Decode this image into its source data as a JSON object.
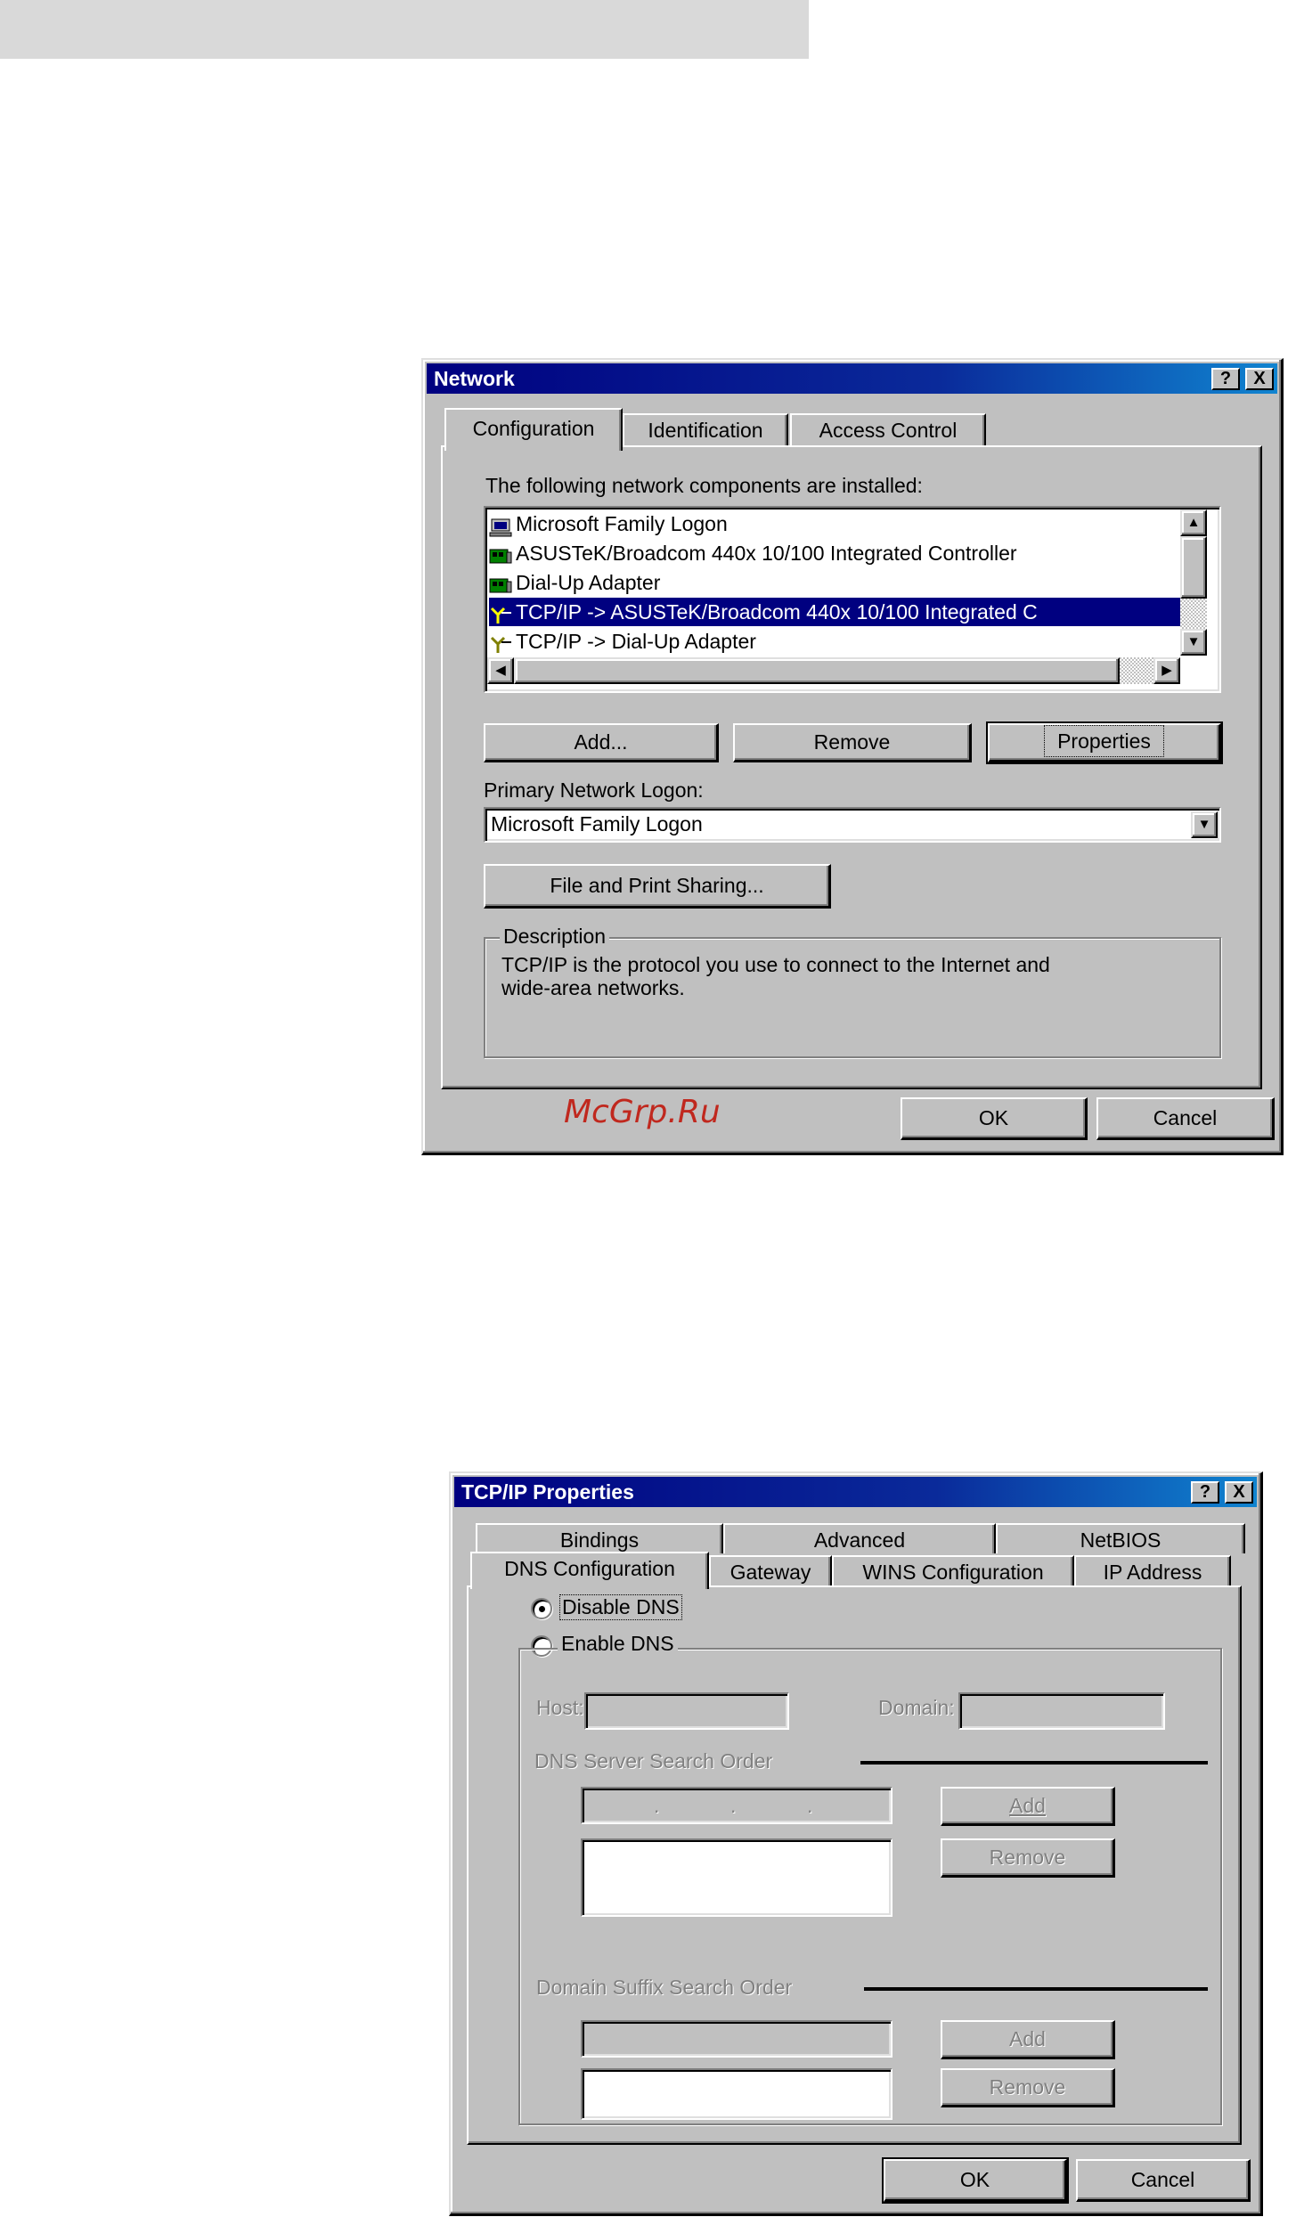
{
  "network": {
    "title": "Network",
    "help_btn": "?",
    "close_btn": "X",
    "tabs": [
      "Configuration",
      "Identification",
      "Access Control"
    ],
    "installed_label": "The following network components are installed:",
    "components": [
      {
        "label": "Microsoft Family Logon",
        "icon": "computer-icon",
        "selected": false
      },
      {
        "label": "ASUSTeK/Broadcom 440x 10/100 Integrated Controller",
        "icon": "network-card-icon",
        "selected": false
      },
      {
        "label": "Dial-Up Adapter",
        "icon": "network-card-icon",
        "selected": false
      },
      {
        "label": "TCP/IP -> ASUSTeK/Broadcom 440x 10/100 Integrated C",
        "icon": "protocol-icon",
        "selected": true
      },
      {
        "label": "TCP/IP -> Dial-Up Adapter",
        "icon": "protocol-icon",
        "selected": false
      }
    ],
    "buttons": {
      "add": "Add...",
      "remove": "Remove",
      "properties": "Properties"
    },
    "primary_logon_label": "Primary Network Logon:",
    "primary_logon_value": "Microsoft Family Logon",
    "file_print_sharing": "File and Print Sharing...",
    "description_title": "Description",
    "description_line1": "TCP/IP is the protocol you use to connect to the Internet and",
    "description_line2": "wide-area networks.",
    "ok": "OK",
    "cancel": "Cancel"
  },
  "watermark": "McGrp.Ru",
  "tcpip": {
    "title": "TCP/IP Properties",
    "help_btn": "?",
    "close_btn": "X",
    "tabs_back": [
      "Bindings",
      "Advanced",
      "NetBIOS"
    ],
    "tabs_front": [
      "DNS Configuration",
      "Gateway",
      "WINS Configuration",
      "IP Address"
    ],
    "disable_dns": "Disable DNS",
    "enable_dns": "Enable DNS",
    "host_label": "Host:",
    "domain_label": "Domain:",
    "dns_search_order": "DNS Server Search Order",
    "domain_suffix_order": "Domain Suffix Search Order",
    "add": "Add",
    "remove": "Remove",
    "ok": "OK",
    "cancel": "Cancel"
  }
}
